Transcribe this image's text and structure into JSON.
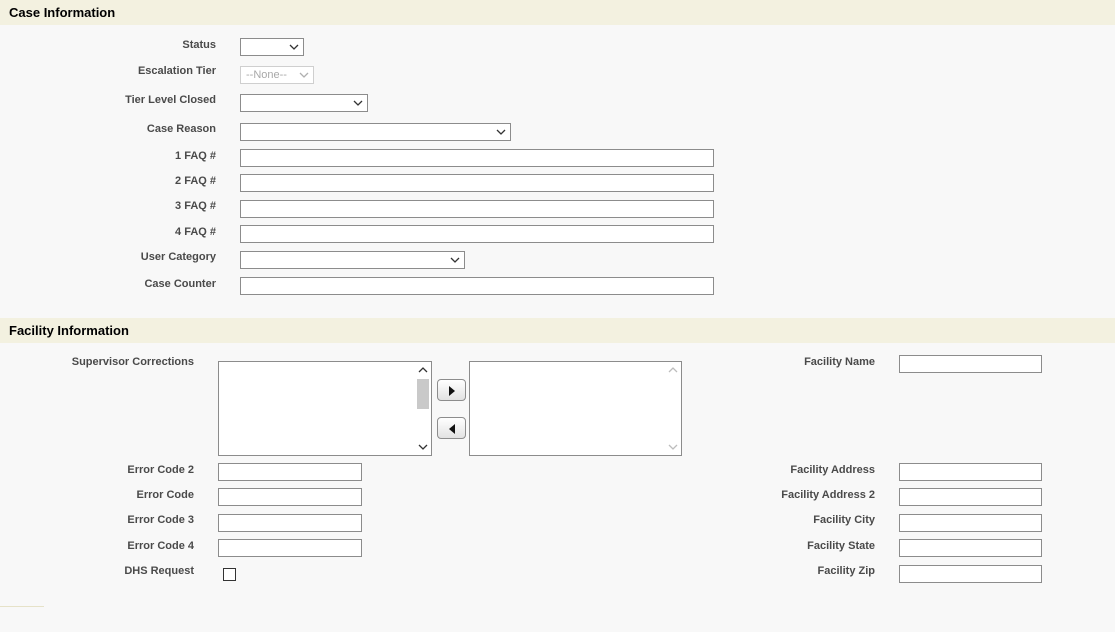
{
  "case_section": {
    "title": "Case Information",
    "status_label": "Status",
    "status_value": "",
    "escalation_tier_label": "Escalation Tier",
    "escalation_tier_value": "--None--",
    "tier_level_closed_label": "Tier Level Closed",
    "tier_level_closed_value": "",
    "case_reason_label": "Case Reason",
    "case_reason_value": "",
    "faq1_label": "1 FAQ #",
    "faq1_value": "",
    "faq2_label": "2 FAQ #",
    "faq2_value": "",
    "faq3_label": "3 FAQ #",
    "faq3_value": "",
    "faq4_label": "4 FAQ #",
    "faq4_value": "",
    "user_category_label": "User Category",
    "user_category_value": "",
    "case_counter_label": "Case Counter",
    "case_counter_value": ""
  },
  "facility_section": {
    "title": "Facility Information",
    "supervisor_corrections_label": "Supervisor Corrections",
    "available_options": [],
    "selected_options": [],
    "error_code_2_label": "Error Code 2",
    "error_code_label": "Error Code",
    "error_code_3_label": "Error Code 3",
    "error_code_4_label": "Error Code 4",
    "dhs_request_label": "DHS Request",
    "dhs_request_checked": false,
    "facility_name_label": "Facility Name",
    "facility_address_label": "Facility Address",
    "facility_address_2_label": "Facility Address 2",
    "facility_city_label": "Facility City",
    "facility_state_label": "Facility State",
    "facility_zip_label": "Facility Zip"
  },
  "icons": {
    "dropdown": "chevron-down-icon",
    "move_right": "triangle-right-icon",
    "move_left": "triangle-left-icon",
    "scroll_up": "chevron-up-icon",
    "scroll_down": "chevron-down-icon"
  },
  "colors": {
    "section_header_bg": "#f3f1e0",
    "page_bg": "#f8f8f8",
    "label_text": "#4a4a4a",
    "field_border": "#8c8c8c"
  }
}
